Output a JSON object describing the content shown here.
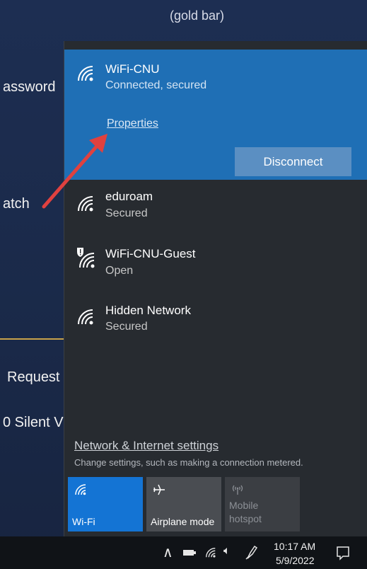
{
  "background": {
    "gold_bar": "(gold bar)",
    "line1": "assword",
    "line2": "atch",
    "line3": "Request",
    "line4": "0 Silent V"
  },
  "networks": [
    {
      "name": "WiFi-CNU",
      "status": "Connected, secured",
      "selected": true,
      "properties_label": "Properties",
      "disconnect_label": "Disconnect"
    },
    {
      "name": "eduroam",
      "status": "Secured"
    },
    {
      "name": "WiFi-CNU-Guest",
      "status": "Open"
    },
    {
      "name": "Hidden Network",
      "status": "Secured"
    }
  ],
  "settings": {
    "link": "Network & Internet settings",
    "sub": "Change settings, such as making a connection metered."
  },
  "tiles": [
    {
      "label": "Wi-Fi",
      "icon": "wifi-icon",
      "active": true
    },
    {
      "label": "Airplane mode",
      "icon": "airplane-icon",
      "active": false
    },
    {
      "label": "Mobile hotspot",
      "icon": "hotspot-icon",
      "active": false,
      "disabled": true
    }
  ],
  "taskbar": {
    "time": "10:17 AM",
    "date": "5/9/2022",
    "icons": [
      "chevron-up-icon",
      "battery-icon",
      "wifi-icon",
      "volume-icon",
      "pen-icon",
      "notification-icon"
    ]
  },
  "colors": {
    "accent": "#1f6fb5",
    "tile_active": "#1474d4",
    "arrow": "#e0413f"
  }
}
